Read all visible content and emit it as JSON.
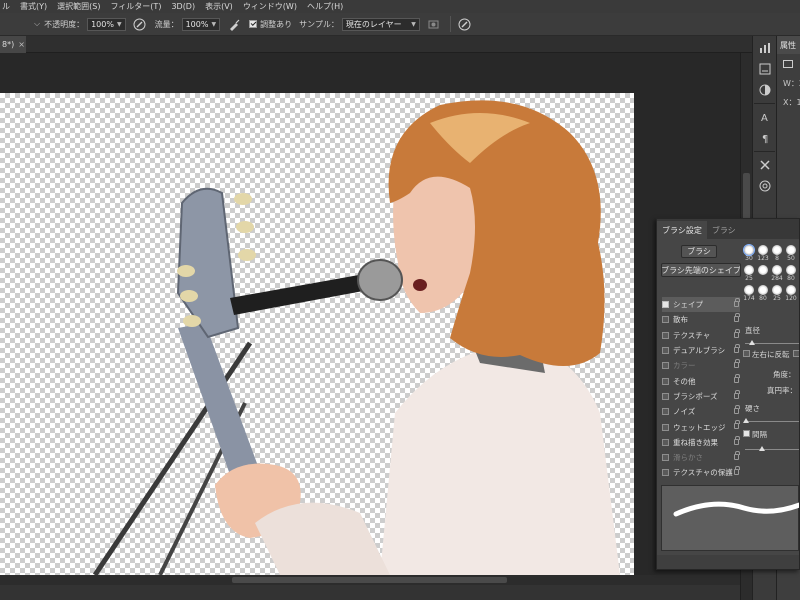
{
  "menubar": {
    "items": [
      "ル",
      "書式(Y)",
      "選択範囲(S)",
      "フィルター(T)",
      "3D(D)",
      "表示(V)",
      "ウィンドウ(W)",
      "ヘルプ(H)"
    ]
  },
  "options": {
    "mode_caret": "⌵",
    "opacity_label": "不透明度：",
    "opacity_value": "100%",
    "flow_label": "流量：",
    "flow_value": "100%",
    "aligned_label": "調整あり",
    "sample_label": "サンプル：",
    "sample_value": "現在のレイヤー"
  },
  "document": {
    "tab_title": "8*)",
    "close_glyph": "×"
  },
  "properties_panel": {
    "tab_label": "属性",
    "w_label": "W：",
    "w_value": "2",
    "x_label": "X：",
    "x_value": "1"
  },
  "brush_panel": {
    "tabs": [
      "ブラシ設定",
      "ブラシ"
    ],
    "brushes_button": "ブラシ",
    "tip_shape_button": "ブラシ先端のシェイプ",
    "options": [
      {
        "label": "シェイプ",
        "checked": true,
        "enabled": true
      },
      {
        "label": "散布",
        "checked": false,
        "enabled": true
      },
      {
        "label": "テクスチャ",
        "checked": false,
        "enabled": true
      },
      {
        "label": "デュアルブラシ",
        "checked": false,
        "enabled": true
      },
      {
        "label": "カラー",
        "checked": false,
        "enabled": false
      },
      {
        "label": "その他",
        "checked": false,
        "enabled": true
      },
      {
        "label": "ブラシポーズ",
        "checked": false,
        "enabled": true
      },
      {
        "label": "ノイズ",
        "checked": false,
        "enabled": true
      },
      {
        "label": "ウェットエッジ",
        "checked": false,
        "enabled": true
      },
      {
        "label": "重ね描き効果",
        "checked": false,
        "enabled": true
      },
      {
        "label": "滑らかさ",
        "checked": false,
        "enabled": false
      },
      {
        "label": "テクスチャの保護",
        "checked": false,
        "enabled": true
      }
    ],
    "tip_sizes": [
      "30",
      "123",
      "8",
      "50",
      "25",
      "",
      "284",
      "80",
      "174",
      "80",
      "25",
      "120"
    ],
    "size_label": "直径",
    "flip_x_label": "左右に反転",
    "angle_label": "角度：",
    "roundness_label": "真円率：",
    "hardness_label": "硬さ",
    "spacing_label": "間隔"
  },
  "colors": {
    "ui_dark": "#282828",
    "panel": "#464646",
    "checker": "#cdcdcd"
  }
}
